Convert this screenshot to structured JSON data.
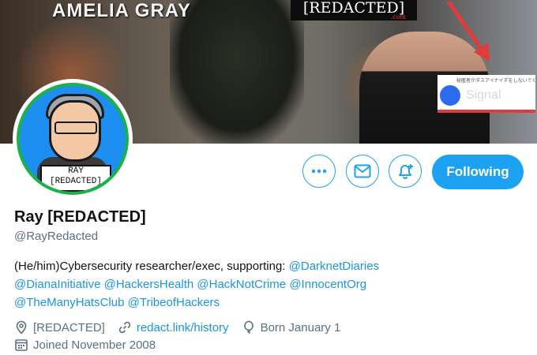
{
  "banner": {
    "name_text": "AMELIA GRAY",
    "logo_text": "[REDACTED]",
    "logo_sub": ".com",
    "signal_jp": "秘匿者がダスアイナイずをしないでください",
    "signal_label": "Signal"
  },
  "avatar": {
    "tag_line1": "RAY",
    "tag_line2": "[REDACTED]"
  },
  "actions": {
    "follow_label": "Following"
  },
  "profile": {
    "name": "Ray [REDACTED]",
    "handle": "@RayRedacted",
    "bio_prefix": "(He/him)Cybersecurity researcher/exec, supporting: ",
    "bio_mentions": [
      "@DarknetDiaries",
      "@DianaInitiative",
      "@HackersHealth",
      "@HackNotCrime",
      "@InnocentOrg",
      "@TheManyHatsClub",
      "@TribeofHackers"
    ],
    "location": "[REDACTED]",
    "website": "redact.link/history",
    "birthday": "Born January 1",
    "joined": "Joined November 2008"
  },
  "colors": {
    "accent": "#1da1f2",
    "secondary_text": "#5b7083",
    "avatar_ring": "#19b34a"
  }
}
